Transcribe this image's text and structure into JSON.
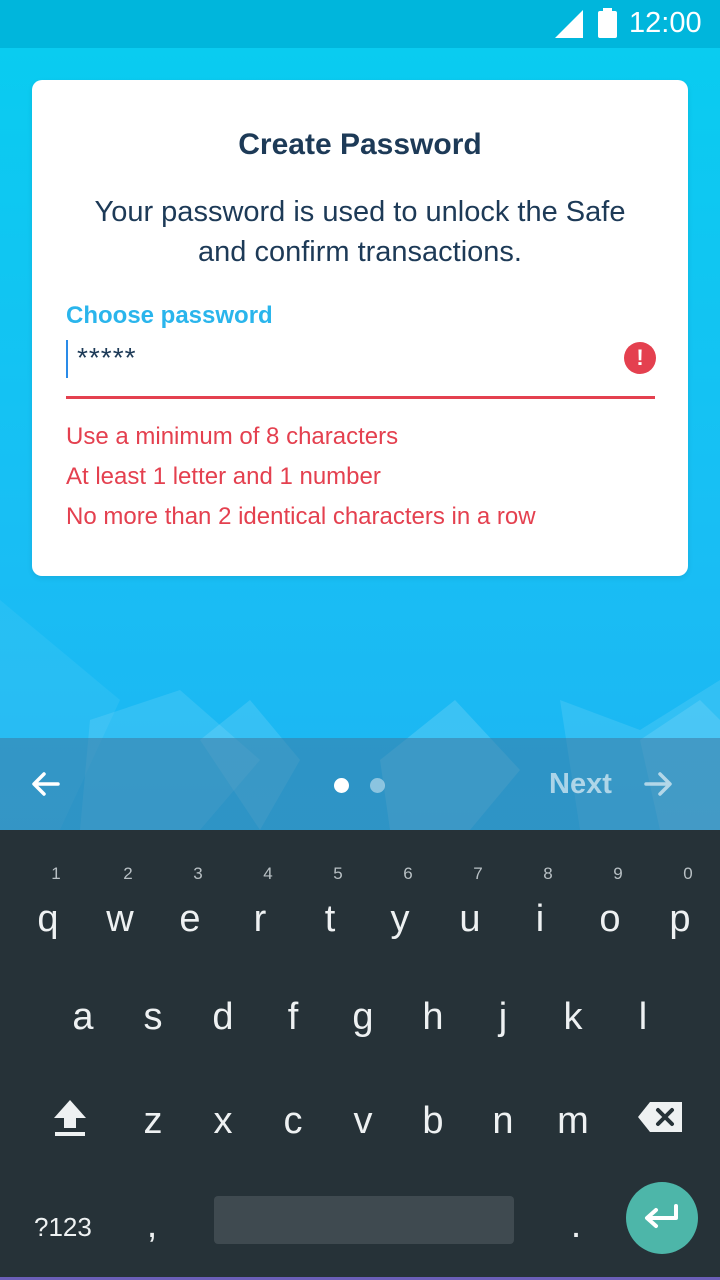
{
  "status_bar": {
    "time": "12:00"
  },
  "card": {
    "title": "Create Password",
    "description": "Your password is used to unlock the Safe and confirm transactions.",
    "field": {
      "label": "Choose password",
      "value": "*****",
      "error_icon": "!"
    },
    "rules": [
      "Use a minimum of 8 characters",
      "At least 1 letter and 1 number",
      "No more than 2 identical characters in a row"
    ]
  },
  "navigation": {
    "back_icon": "arrow-left-icon",
    "next_label": "Next",
    "next_icon": "arrow-right-icon",
    "page_count": 2,
    "current_page": 1
  },
  "keyboard": {
    "row1": [
      "q",
      "w",
      "e",
      "r",
      "t",
      "y",
      "u",
      "i",
      "o",
      "p"
    ],
    "row1_hints": [
      "1",
      "2",
      "3",
      "4",
      "5",
      "6",
      "7",
      "8",
      "9",
      "0"
    ],
    "row2": [
      "a",
      "s",
      "d",
      "f",
      "g",
      "h",
      "j",
      "k",
      "l"
    ],
    "row3": [
      "z",
      "x",
      "c",
      "v",
      "b",
      "n",
      "m"
    ],
    "symbols_label": "?123",
    "comma": ",",
    "period": "."
  },
  "colors": {
    "accent": "#2ab5ec",
    "error": "#e4404f",
    "title_text": "#1d3a57",
    "keyboard_bg": "#263238",
    "enter_key": "#4db6a9"
  }
}
